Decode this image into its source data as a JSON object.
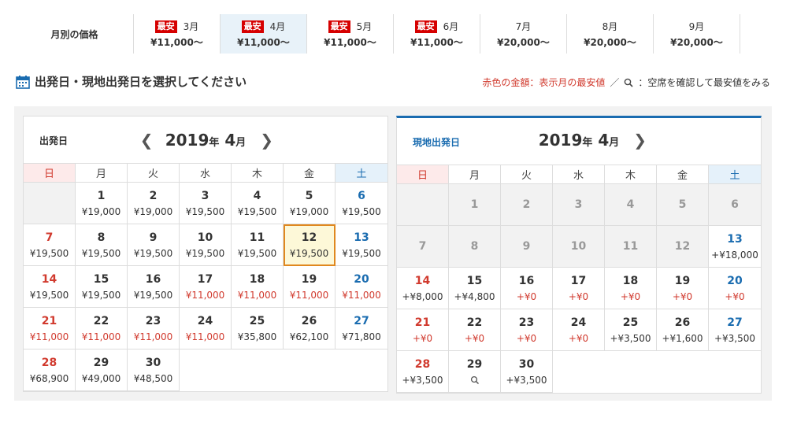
{
  "month_tabs": {
    "label": "月別の価格",
    "badge": "最安",
    "items": [
      {
        "month": "3月",
        "price": "¥11,000～",
        "cheapest": true,
        "active": false
      },
      {
        "month": "4月",
        "price": "¥11,000～",
        "cheapest": true,
        "active": true
      },
      {
        "month": "5月",
        "price": "¥11,000～",
        "cheapest": true,
        "active": false
      },
      {
        "month": "6月",
        "price": "¥11,000～",
        "cheapest": true,
        "active": false
      },
      {
        "month": "7月",
        "price": "¥20,000～",
        "cheapest": false,
        "active": false
      },
      {
        "month": "8月",
        "price": "¥20,000～",
        "cheapest": false,
        "active": false
      },
      {
        "month": "9月",
        "price": "¥20,000～",
        "cheapest": false,
        "active": false
      }
    ]
  },
  "heading": {
    "title": "出発日・現地出発日を選択してください",
    "legend_red": "赤色の金額：表示月の最安値",
    "legend_sep": "／",
    "legend_note": "：空席を確認して最安値をみる"
  },
  "weekdays": [
    "日",
    "月",
    "火",
    "水",
    "木",
    "金",
    "土"
  ],
  "colors": {
    "red": "#d13a2e",
    "blue": "#1a6cb0",
    "highlight": "#e0881f",
    "badge": "#d60000"
  },
  "departure_calendar": {
    "label": "出発日",
    "year": "2019",
    "year_unit": "年",
    "month": "4",
    "month_unit": "月",
    "weeks": [
      [
        null,
        {
          "d": "1",
          "p": "¥19,000"
        },
        {
          "d": "2",
          "p": "¥19,000"
        },
        {
          "d": "3",
          "p": "¥19,500"
        },
        {
          "d": "4",
          "p": "¥19,500"
        },
        {
          "d": "5",
          "p": "¥19,000"
        },
        {
          "d": "6",
          "p": "¥19,500"
        }
      ],
      [
        {
          "d": "7",
          "p": "¥19,500"
        },
        {
          "d": "8",
          "p": "¥19,500"
        },
        {
          "d": "9",
          "p": "¥19,500"
        },
        {
          "d": "10",
          "p": "¥19,500"
        },
        {
          "d": "11",
          "p": "¥19,500"
        },
        {
          "d": "12",
          "p": "¥19,500",
          "selected": true
        },
        {
          "d": "13",
          "p": "¥19,500"
        }
      ],
      [
        {
          "d": "14",
          "p": "¥19,500"
        },
        {
          "d": "15",
          "p": "¥19,500"
        },
        {
          "d": "16",
          "p": "¥19,500"
        },
        {
          "d": "17",
          "p": "¥11,000",
          "red": true
        },
        {
          "d": "18",
          "p": "¥11,000",
          "red": true
        },
        {
          "d": "19",
          "p": "¥11,000",
          "red": true
        },
        {
          "d": "20",
          "p": "¥11,000",
          "red": true
        }
      ],
      [
        {
          "d": "21",
          "p": "¥11,000",
          "red": true
        },
        {
          "d": "22",
          "p": "¥11,000",
          "red": true
        },
        {
          "d": "23",
          "p": "¥11,000",
          "red": true
        },
        {
          "d": "24",
          "p": "¥11,000",
          "red": true
        },
        {
          "d": "25",
          "p": "¥35,800"
        },
        {
          "d": "26",
          "p": "¥62,100"
        },
        {
          "d": "27",
          "p": "¥71,800"
        }
      ],
      [
        {
          "d": "28",
          "p": "¥68,900"
        },
        {
          "d": "29",
          "p": "¥49,000"
        },
        {
          "d": "30",
          "p": "¥48,500"
        },
        "blank",
        "blank",
        "blank",
        "blank"
      ]
    ]
  },
  "return_calendar": {
    "label": "現地出発日",
    "year": "2019",
    "year_unit": "年",
    "month": "4",
    "month_unit": "月",
    "weeks": [
      [
        {
          "d": "",
          "disabled": true
        },
        {
          "d": "1",
          "disabled": true
        },
        {
          "d": "2",
          "disabled": true
        },
        {
          "d": "3",
          "disabled": true
        },
        {
          "d": "4",
          "disabled": true
        },
        {
          "d": "5",
          "disabled": true
        },
        {
          "d": "6",
          "disabled": true
        }
      ],
      [
        {
          "d": "7",
          "disabled": true
        },
        {
          "d": "8",
          "disabled": true
        },
        {
          "d": "9",
          "disabled": true
        },
        {
          "d": "10",
          "disabled": true
        },
        {
          "d": "11",
          "disabled": true
        },
        {
          "d": "12",
          "disabled": true
        },
        {
          "d": "13",
          "p": "+¥18,000"
        }
      ],
      [
        {
          "d": "14",
          "p": "+¥8,000"
        },
        {
          "d": "15",
          "p": "+¥4,800"
        },
        {
          "d": "16",
          "p": "+¥0",
          "red": true
        },
        {
          "d": "17",
          "p": "+¥0",
          "red": true
        },
        {
          "d": "18",
          "p": "+¥0",
          "red": true
        },
        {
          "d": "19",
          "p": "+¥0",
          "red": true
        },
        {
          "d": "20",
          "p": "+¥0",
          "red": true
        }
      ],
      [
        {
          "d": "21",
          "p": "+¥0",
          "red": true
        },
        {
          "d": "22",
          "p": "+¥0",
          "red": true
        },
        {
          "d": "23",
          "p": "+¥0",
          "red": true
        },
        {
          "d": "24",
          "p": "+¥0",
          "red": true
        },
        {
          "d": "25",
          "p": "+¥3,500"
        },
        {
          "d": "26",
          "p": "+¥1,600"
        },
        {
          "d": "27",
          "p": "+¥3,500"
        }
      ],
      [
        {
          "d": "28",
          "p": "+¥3,500"
        },
        {
          "d": "29",
          "search": true
        },
        {
          "d": "30",
          "p": "+¥3,500"
        },
        "blank",
        "blank",
        "blank",
        "blank"
      ]
    ]
  }
}
